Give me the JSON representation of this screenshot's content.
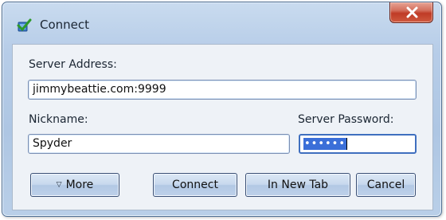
{
  "window": {
    "title": "Connect",
    "close_glyph": "X",
    "icon": "checkmark-plug-icon"
  },
  "form": {
    "server_address_label": "Server Address:",
    "server_address_value": "jimmybeattie.com:9999",
    "nickname_label": "Nickname:",
    "nickname_value": "Spyder",
    "password_label": "Server Password:",
    "password_mask": "••••••"
  },
  "buttons": {
    "more_label": "More",
    "more_icon": "triangle-down-icon",
    "connect_label": "Connect",
    "new_tab_label": "In New Tab",
    "cancel_label": "Cancel"
  },
  "colors": {
    "accent": "#3f6fbf",
    "close": "#c5432b"
  }
}
